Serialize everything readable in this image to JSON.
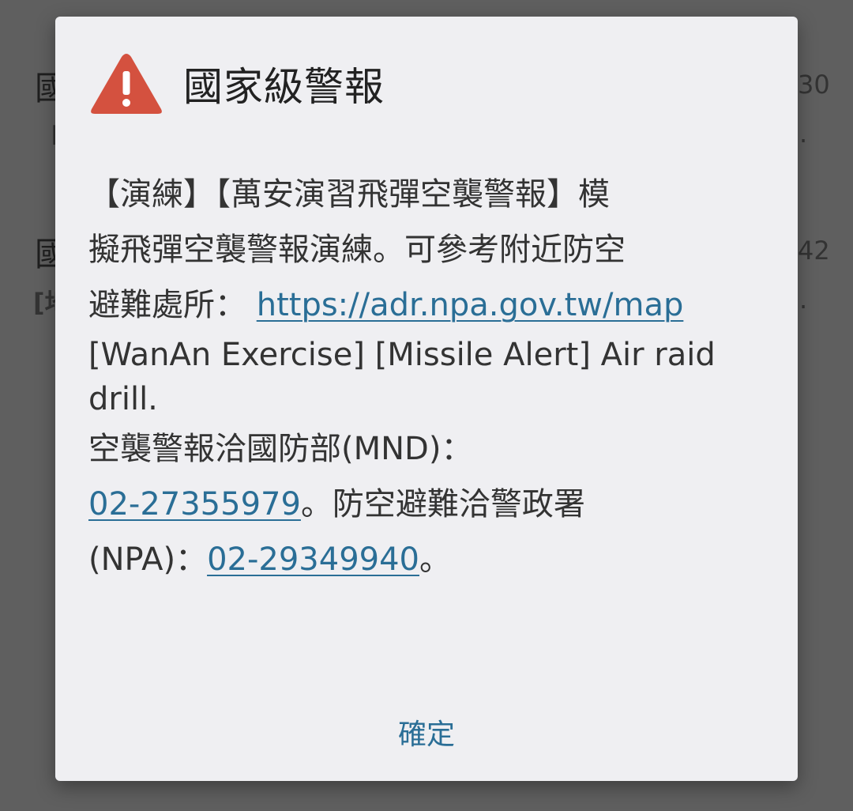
{
  "background": {
    "items": [
      {
        "title": "國",
        "subtitle": "I",
        "time": "30",
        "overflow": "."
      },
      {
        "title": "國",
        "subtitle": "[地",
        "time": "42",
        "overflow": "."
      }
    ]
  },
  "dialog": {
    "icon": "warning-triangle-icon",
    "icon_color": "#d4513f",
    "title": "國家級警報",
    "body": {
      "line1": "【演練】【萬安演習飛彈空襲警報】模",
      "line2": "擬飛彈空襲警報演練。可參考附近防空",
      "line3_prefix": "避難處所： ",
      "map_link": "https://adr.npa.gov.tw/map",
      "line4": "[WanAn Exercise] [Missile Alert] Air raid",
      "line5": "drill.",
      "line6": "空襲警報洽國防部(MND)：",
      "mnd_phone": "02-27355979",
      "line7_suffix": "。防空避難洽警政署",
      "line8_prefix": "(NPA)：",
      "npa_phone": "02-29349940",
      "line8_suffix": "。"
    },
    "ok_label": "確定"
  },
  "colors": {
    "link": "#2a6e96",
    "dialog_bg": "#efeff2",
    "scrim": "#5f5f5f"
  }
}
